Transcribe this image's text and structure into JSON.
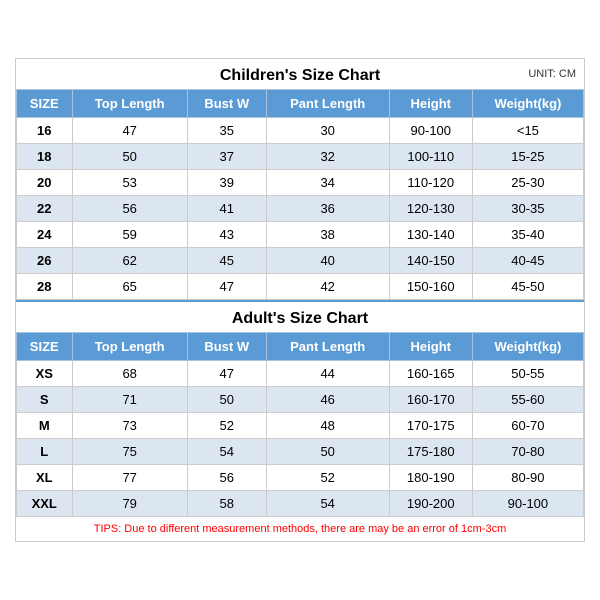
{
  "children_chart": {
    "title": "Children's Size Chart",
    "unit": "UNIT: CM",
    "headers": [
      "SIZE",
      "Top Length",
      "Bust W",
      "Pant Length",
      "Height",
      "Weight(kg)"
    ],
    "rows": [
      [
        "16",
        "47",
        "35",
        "30",
        "90-100",
        "<15"
      ],
      [
        "18",
        "50",
        "37",
        "32",
        "100-110",
        "15-25"
      ],
      [
        "20",
        "53",
        "39",
        "34",
        "110-120",
        "25-30"
      ],
      [
        "22",
        "56",
        "41",
        "36",
        "120-130",
        "30-35"
      ],
      [
        "24",
        "59",
        "43",
        "38",
        "130-140",
        "35-40"
      ],
      [
        "26",
        "62",
        "45",
        "40",
        "140-150",
        "40-45"
      ],
      [
        "28",
        "65",
        "47",
        "42",
        "150-160",
        "45-50"
      ]
    ]
  },
  "adults_chart": {
    "title": "Adult's Size Chart",
    "headers": [
      "SIZE",
      "Top Length",
      "Bust W",
      "Pant Length",
      "Height",
      "Weight(kg)"
    ],
    "rows": [
      [
        "XS",
        "68",
        "47",
        "44",
        "160-165",
        "50-55"
      ],
      [
        "S",
        "71",
        "50",
        "46",
        "160-170",
        "55-60"
      ],
      [
        "M",
        "73",
        "52",
        "48",
        "170-175",
        "60-70"
      ],
      [
        "L",
        "75",
        "54",
        "50",
        "175-180",
        "70-80"
      ],
      [
        "XL",
        "77",
        "56",
        "52",
        "180-190",
        "80-90"
      ],
      [
        "XXL",
        "79",
        "58",
        "54",
        "190-200",
        "90-100"
      ]
    ]
  },
  "tips": "TIPS: Due to different measurement methods, there are may be an error of 1cm-3cm"
}
